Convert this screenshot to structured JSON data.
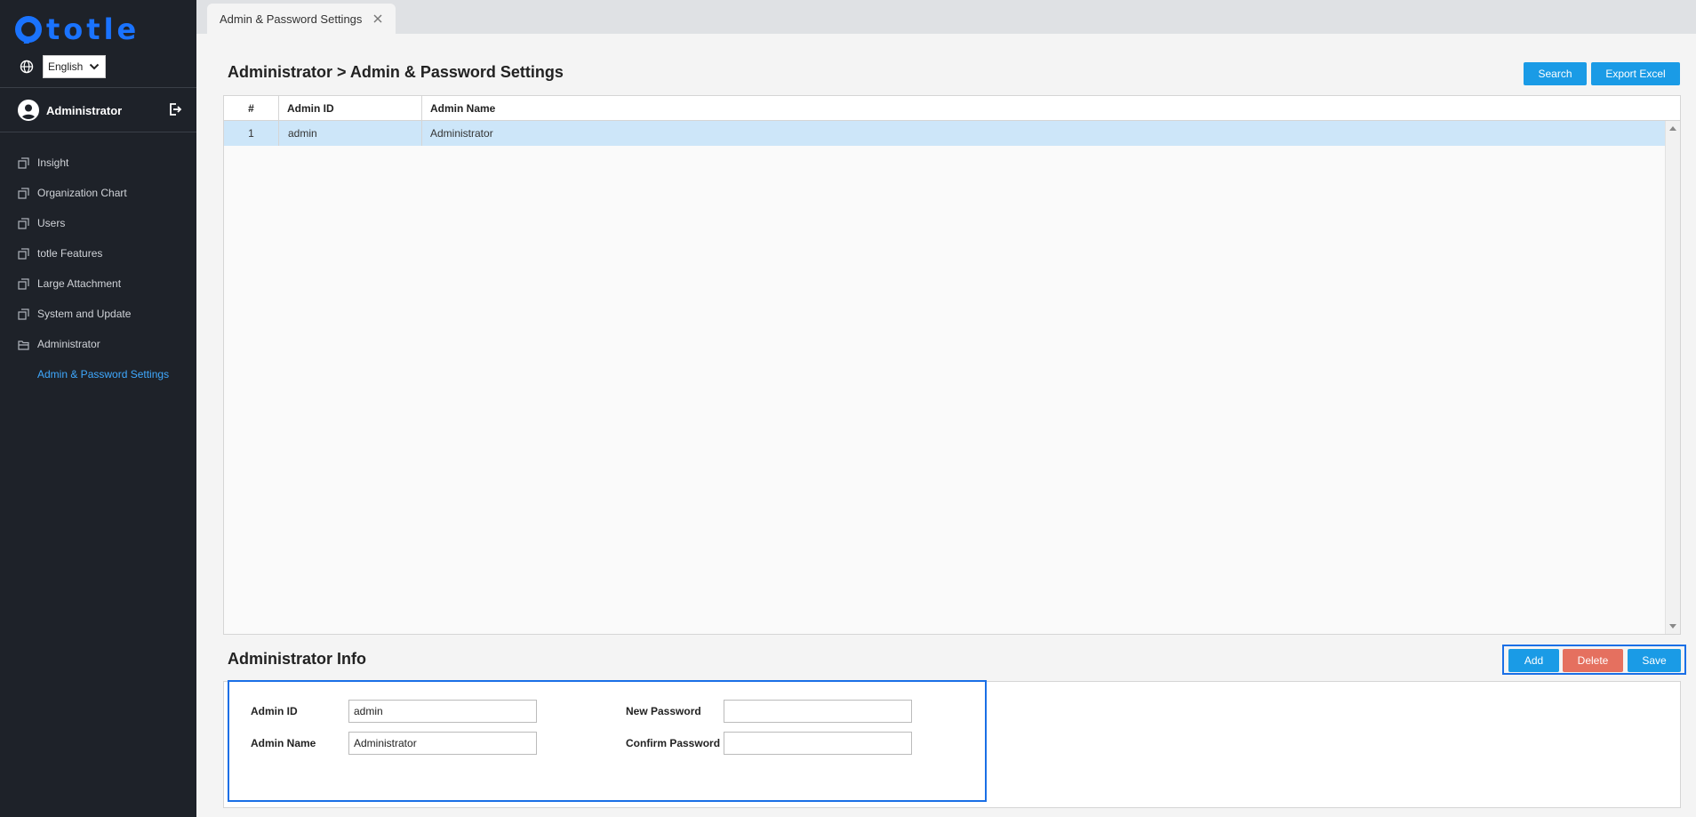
{
  "brand": {
    "logo_text": "totle",
    "accent": "#1a73ff"
  },
  "language": {
    "icon": "globe-icon",
    "selected": "English"
  },
  "user": {
    "name": "Administrator",
    "avatar_icon": "user-icon",
    "logout_icon": "logout-icon"
  },
  "nav": {
    "items": [
      {
        "label": "Insight"
      },
      {
        "label": "Organization Chart"
      },
      {
        "label": "Users"
      },
      {
        "label": "totle Features"
      },
      {
        "label": "Large Attachment"
      },
      {
        "label": "System and Update"
      },
      {
        "label": "Administrator"
      }
    ],
    "sub_active": "Admin & Password Settings",
    "active_color": "#3fa9ff"
  },
  "tabs": [
    {
      "label": "Admin & Password Settings",
      "close_icon": "close-icon"
    }
  ],
  "page": {
    "title": "Administrator > Admin & Password Settings"
  },
  "toolbar": {
    "search_label": "Search",
    "export_label": "Export Excel"
  },
  "grid": {
    "columns": [
      "#",
      "Admin ID",
      "Admin Name"
    ],
    "rows": [
      {
        "index": "1",
        "admin_id": "admin",
        "admin_name": "Administrator"
      }
    ]
  },
  "info": {
    "title": "Administrator Info",
    "add_label": "Add",
    "delete_label": "Delete",
    "save_label": "Save",
    "admin_id_label": "Admin ID",
    "admin_id_value": "admin",
    "admin_name_label": "Admin Name",
    "admin_name_value": "Administrator",
    "new_password_label": "New Password",
    "new_password_value": "",
    "confirm_password_label": "Confirm Password",
    "confirm_password_value": ""
  },
  "colors": {
    "primary_button": "#1a9be6",
    "danger_button": "#e5705f",
    "highlight_border": "#1a6fe6",
    "selected_row": "#cde6f9"
  }
}
